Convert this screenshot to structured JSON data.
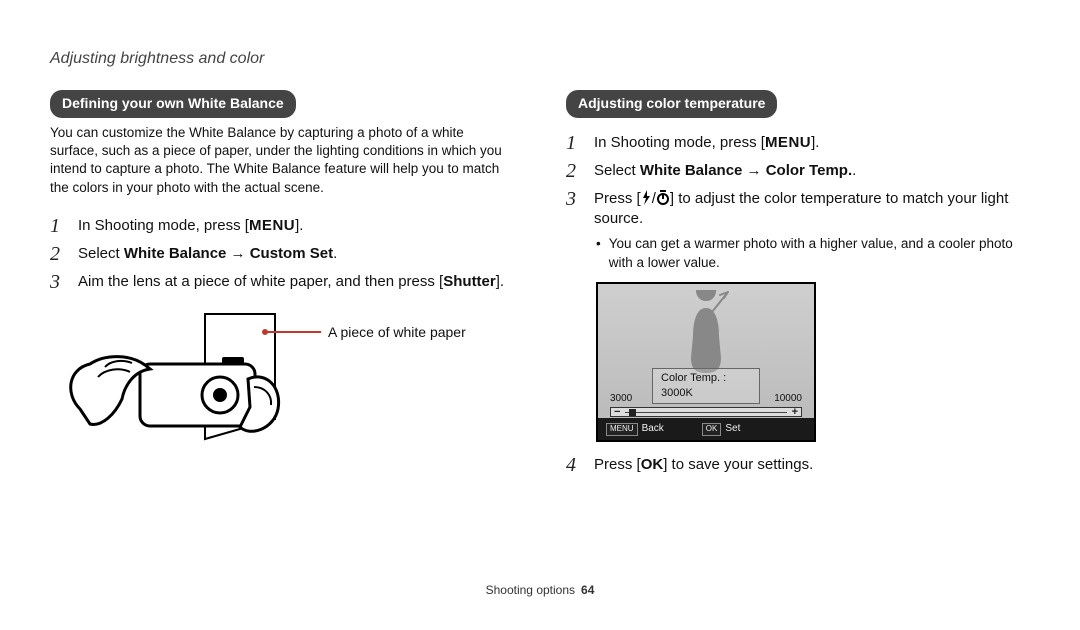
{
  "header": "Adjusting brightness and color",
  "left": {
    "pill": "Defining your own White Balance",
    "intro": "You can customize the White Balance by capturing a photo of a white surface, such as a piece of paper, under the lighting conditions in which you intend to capture a photo. The White Balance feature will help you to match the colors in your photo with the actual scene.",
    "step1_a": "In Shooting mode, press [",
    "step1_menu": "MENU",
    "step1_b": "].",
    "step2_a": "Select ",
    "step2_bold": "White Balance → Custom Set",
    "step2_b": ".",
    "step3_a": "Aim the lens at a piece of white paper, and then press [",
    "step3_bold": "Shutter",
    "step3_b": "].",
    "caption": "A piece of white paper"
  },
  "right": {
    "pill": "Adjusting color temperature",
    "step1_a": "In Shooting mode, press [",
    "step1_menu": "MENU",
    "step1_b": "].",
    "step2_a": "Select ",
    "step2_bold": "White Balance → Color Temp.",
    "step2_b": ".",
    "step3_a": "Press [",
    "step3_mid": "/",
    "step3_b": "] to adjust the color temperature to match your light source.",
    "bullet": "You can get a warmer photo with a higher value, and a cooler photo with a lower value.",
    "lcd_label": "Color Temp. : 3000K",
    "lcd_min": "3000",
    "lcd_max": "10000",
    "lcd_back_tag": "MENU",
    "lcd_back": "Back",
    "lcd_set_tag": "OK",
    "lcd_set": "Set",
    "step4_a": "Press [",
    "step4_ok": "OK",
    "step4_b": "] to save your settings."
  },
  "footer": {
    "section": "Shooting options",
    "page": "64"
  }
}
